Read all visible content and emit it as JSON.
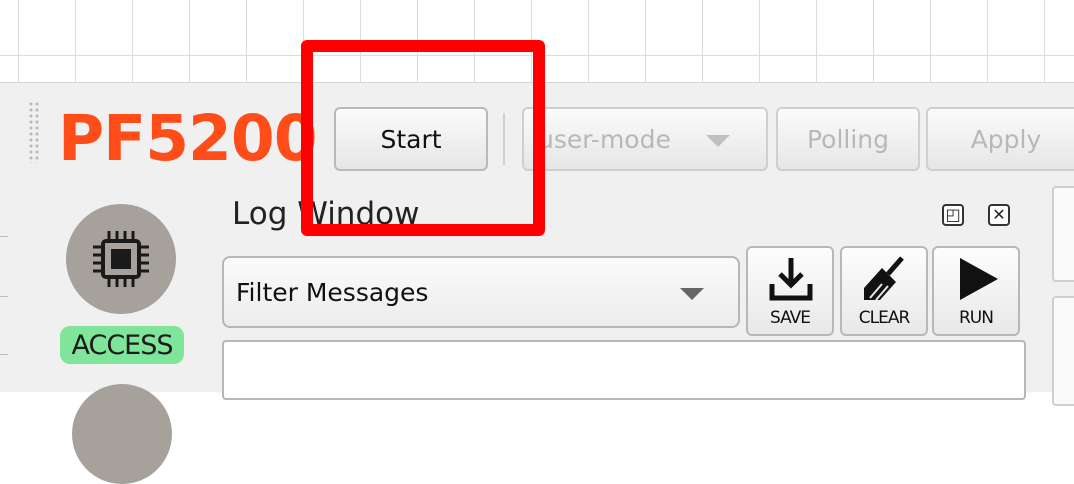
{
  "toolbar": {
    "brand": "PF5200",
    "start_label": "Start",
    "mode_select_value": "user-mode",
    "polling_label": "Polling",
    "apply_label": "Apply"
  },
  "left_panel": {
    "chip_icon": "chip-icon",
    "access_label": "ACCESS",
    "access_color": "#7fe59a"
  },
  "log_window": {
    "title": "Log Window",
    "filter_value": "Filter Messages",
    "buttons": {
      "save": "SAVE",
      "clear": "CLEAR",
      "run": "RUN"
    }
  },
  "colors": {
    "brand": "#ff4d1a",
    "highlight": "#ff0000"
  }
}
